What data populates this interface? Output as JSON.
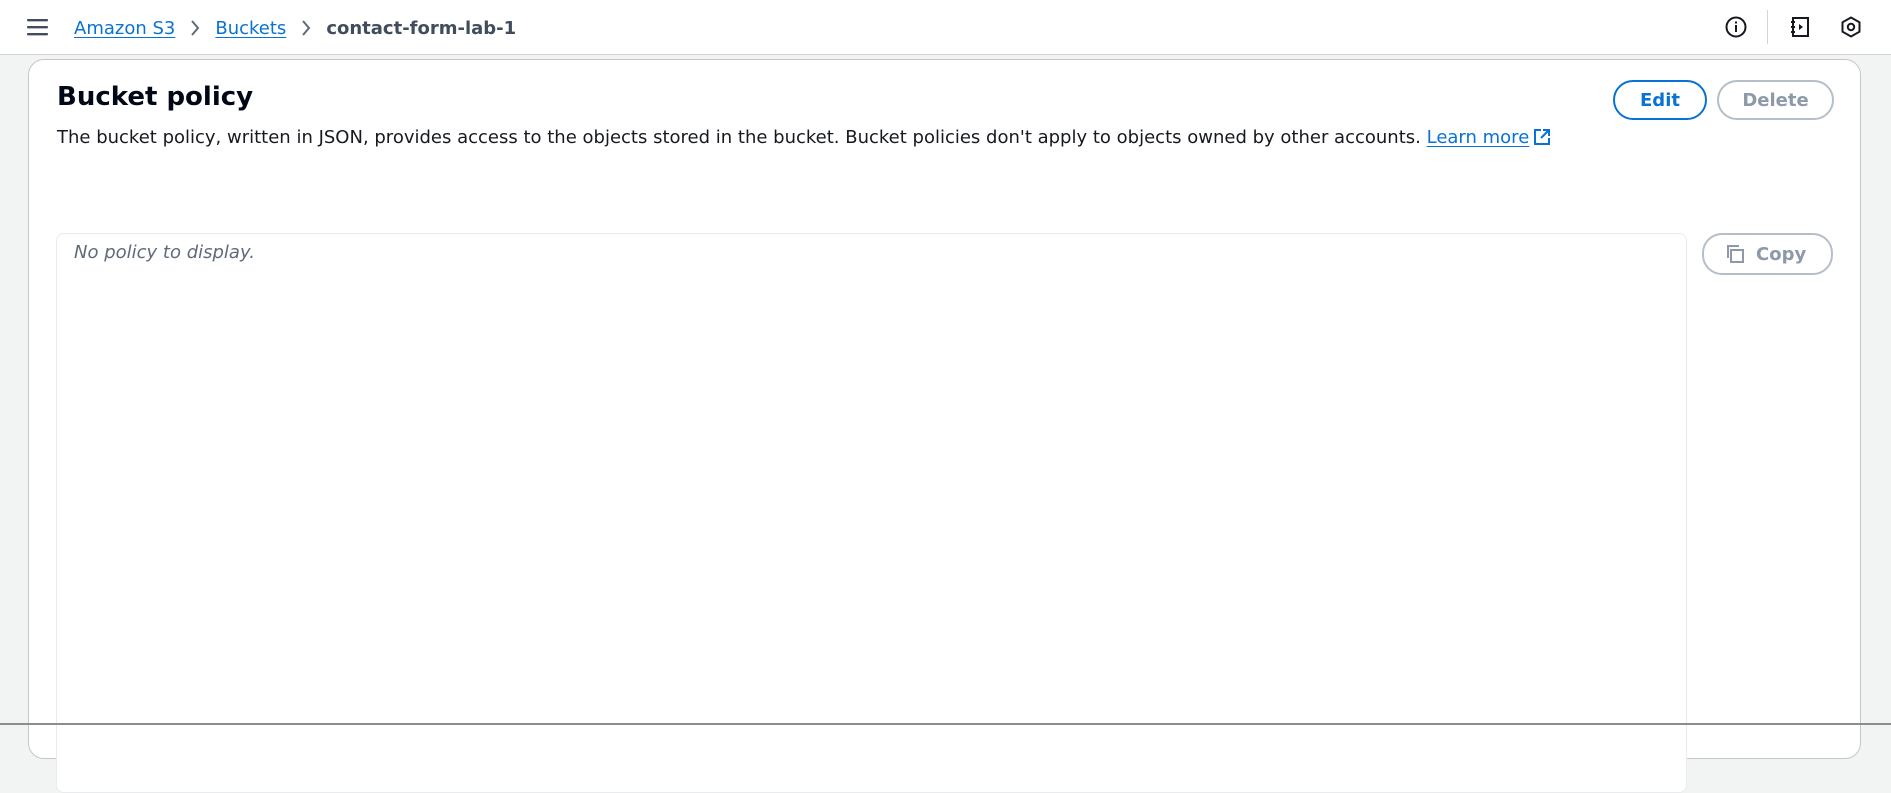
{
  "header": {
    "menu_icon": "hamburger-menu-icon",
    "breadcrumb": {
      "items": [
        "Amazon S3",
        "Buckets"
      ],
      "current": "contact-form-lab-1"
    },
    "icons": [
      "info-icon",
      "notebook-icon",
      "hexagon-settings-icon"
    ]
  },
  "bucket_policy": {
    "title": "Bucket policy",
    "description": "The bucket policy, written in JSON, provides access to the objects stored in the bucket. Bucket policies don't apply to objects owned by other accounts.",
    "learn_more": "Learn more",
    "edit_label": "Edit",
    "delete_label": "Delete",
    "empty_text": "No policy to display.",
    "copy_label": "Copy"
  },
  "colors": {
    "link": "#0972d3",
    "disabled": "#8d99a8",
    "background": "#f2f3f3"
  }
}
